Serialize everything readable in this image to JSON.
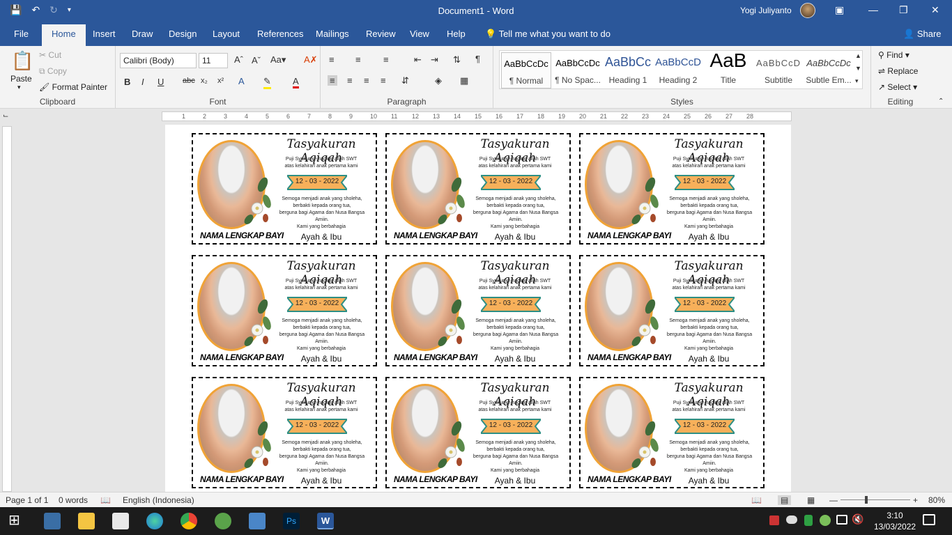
{
  "titlebar": {
    "doc_title": "Document1  -  Word",
    "user": "Yogi Juliyanto"
  },
  "tabs": [
    "File",
    "Home",
    "Insert",
    "Draw",
    "Design",
    "Layout",
    "References",
    "Mailings",
    "Review",
    "View",
    "Help"
  ],
  "tell_me": "Tell me what you want to do",
  "share": "Share",
  "clipboard": {
    "paste": "Paste",
    "cut": "Cut",
    "copy": "Copy",
    "format_painter": "Format Painter",
    "label": "Clipboard"
  },
  "font": {
    "name": "Calibri (Body)",
    "size": "11",
    "label": "Font"
  },
  "paragraph": {
    "label": "Paragraph"
  },
  "styles": {
    "items": [
      {
        "sample": "AaBbCcDc",
        "name": "¶ Normal"
      },
      {
        "sample": "AaBbCcDc",
        "name": "¶ No Spac..."
      },
      {
        "sample": "AaBbCc",
        "name": "Heading 1"
      },
      {
        "sample": "AaBbCcD",
        "name": "Heading 2"
      },
      {
        "sample": "AaB",
        "name": "Title"
      },
      {
        "sample": "AaBbCcD",
        "name": "Subtitle"
      },
      {
        "sample": "AaBbCcDc",
        "name": "Subtle Em..."
      }
    ],
    "label": "Styles"
  },
  "editing": {
    "find": "Find",
    "replace": "Replace",
    "select": "Select",
    "label": "Editing"
  },
  "card": {
    "title": "Tasyakuran Aqiqah",
    "line1": "Puji Syukur ke hadirat allah SWT",
    "line2": "atas kelahiran anak pertama kami",
    "date": "12 - 03 - 2022",
    "wish1": "Semoga menjadi anak yang sholeha,",
    "wish2": "berbakti kepada orang tua,",
    "wish3": "berguna bagi Agama dan Nusa Bangsa",
    "wish4": "Amiin.",
    "kami": "Kami yang berbahagia",
    "nama": "NAMA LENGKAP BAYI",
    "ayah": "Ayah & Ibu"
  },
  "status": {
    "page": "Page 1 of 1",
    "words": "0 words",
    "language": "English (Indonesia)",
    "zoom": "80%"
  },
  "clock": {
    "time": "3:10",
    "date": "13/03/2022"
  },
  "colors": {
    "brand": "#2b579a",
    "ribbon_orange": "#f7b05a",
    "ribbon_teal": "#2e8f84"
  }
}
